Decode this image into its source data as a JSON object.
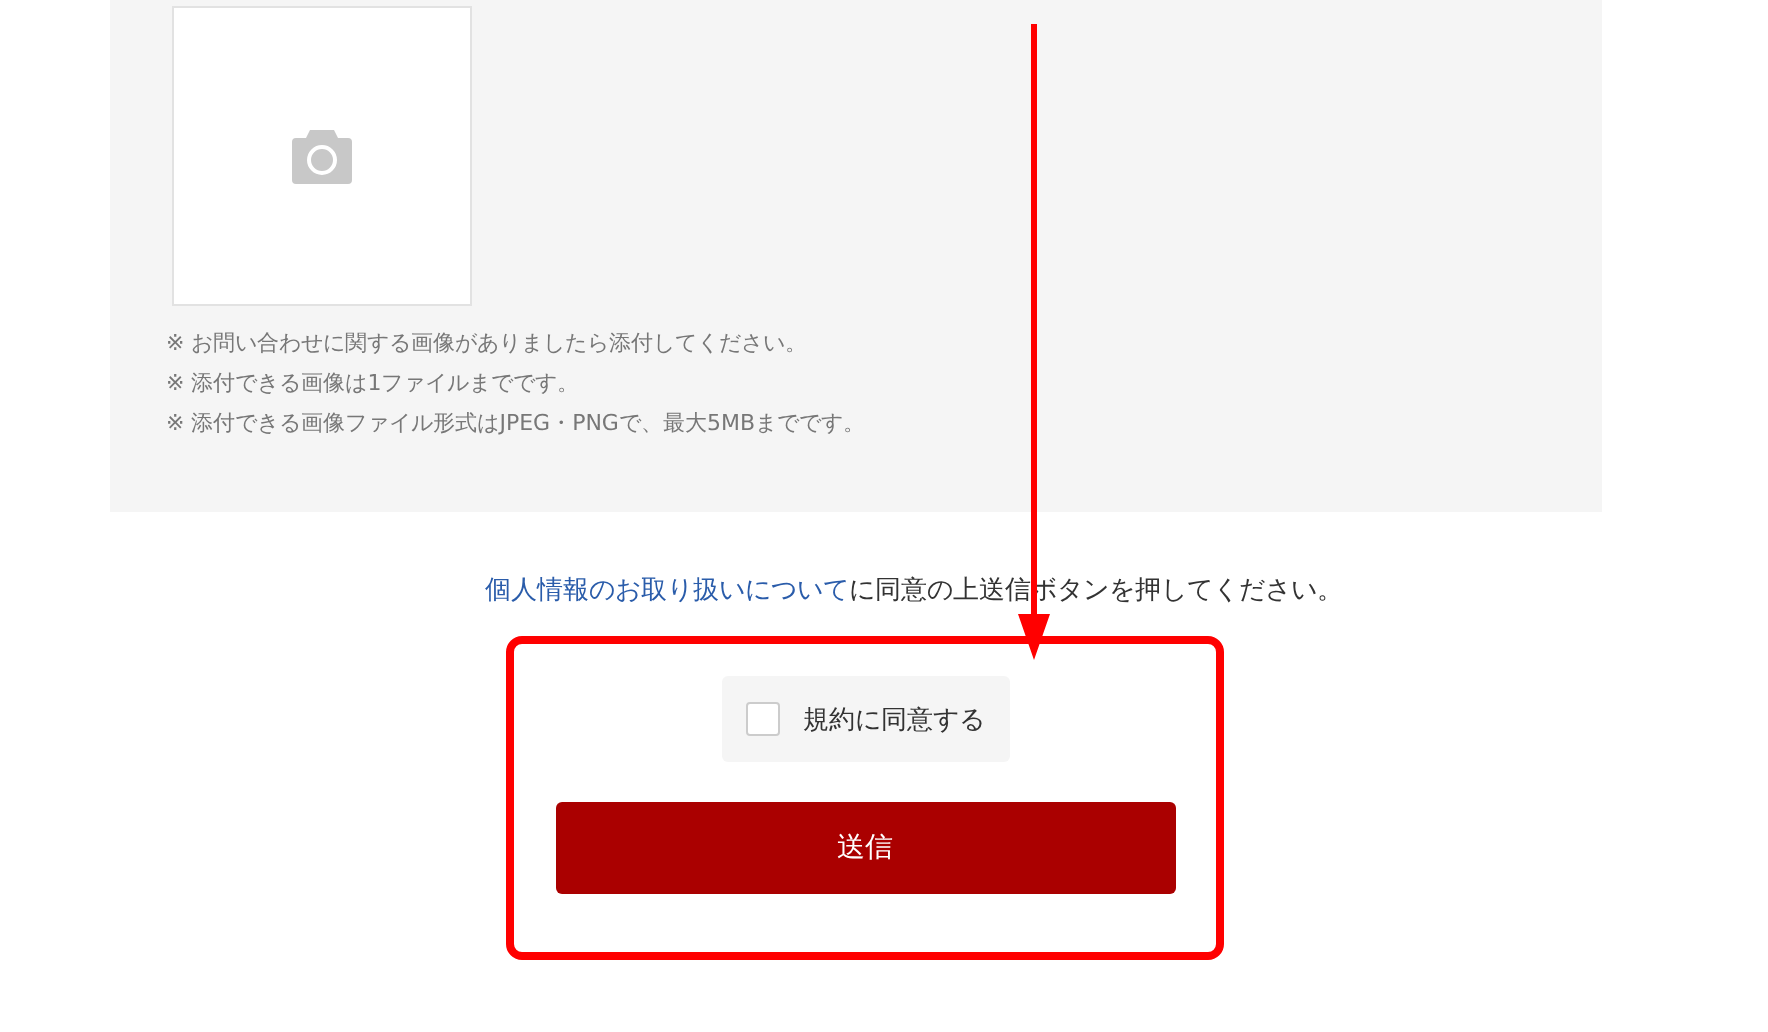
{
  "upload": {
    "notes": [
      "※ お問い合わせに関する画像がありましたら添付してください。",
      "※ 添付できる画像は1ファイルまでです。",
      "※ 添付できる画像ファイル形式はJPEG・PNGで、最大5MBまでです。"
    ]
  },
  "consent": {
    "link": "個人情報のお取り扱いについて",
    "text": "に同意の上送信ボタンを押してください。"
  },
  "agree": {
    "label": "規約に同意する",
    "checked": false
  },
  "submit": {
    "label": "送信"
  }
}
